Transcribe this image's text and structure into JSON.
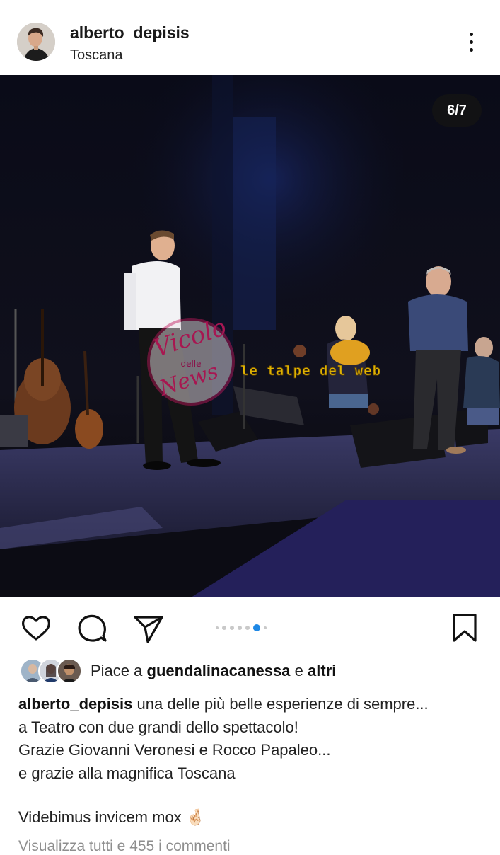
{
  "post": {
    "username": "alberto_depisis",
    "location": "Toscana",
    "image_counter": "6/7",
    "carousel": {
      "total": 7,
      "current": 6
    },
    "watermarks": {
      "vicolo": [
        "Vicolo",
        "delle",
        "News"
      ],
      "talpe": "le talpe del web"
    }
  },
  "likes": {
    "prefix": "Piace a",
    "user": "guendalinacanessa",
    "connector": "e",
    "suffix": "altri"
  },
  "caption": {
    "username": "alberto_depisis",
    "lines": [
      "una delle più belle esperienze di sempre...",
      "a Teatro con due grandi dello spettacolo!",
      "Grazie Giovanni Veronesi e Rocco Papaleo...",
      "e grazie alla magnifica Toscana"
    ],
    "sign_off": "Videbimus invicem mox",
    "emoji": "🤞🏻"
  },
  "comments": {
    "view_all": "Visualizza tutti e 455 i commenti"
  },
  "icons": {
    "like": "heart-icon",
    "comment": "comment-icon",
    "share": "send-icon",
    "save": "bookmark-icon",
    "more": "more-vertical-icon"
  },
  "colors": {
    "accent": "#1e88e5",
    "stage_background": "#0b0b14",
    "watermark_pink": "#c2185b",
    "watermark_yellow": "#f5c400"
  }
}
